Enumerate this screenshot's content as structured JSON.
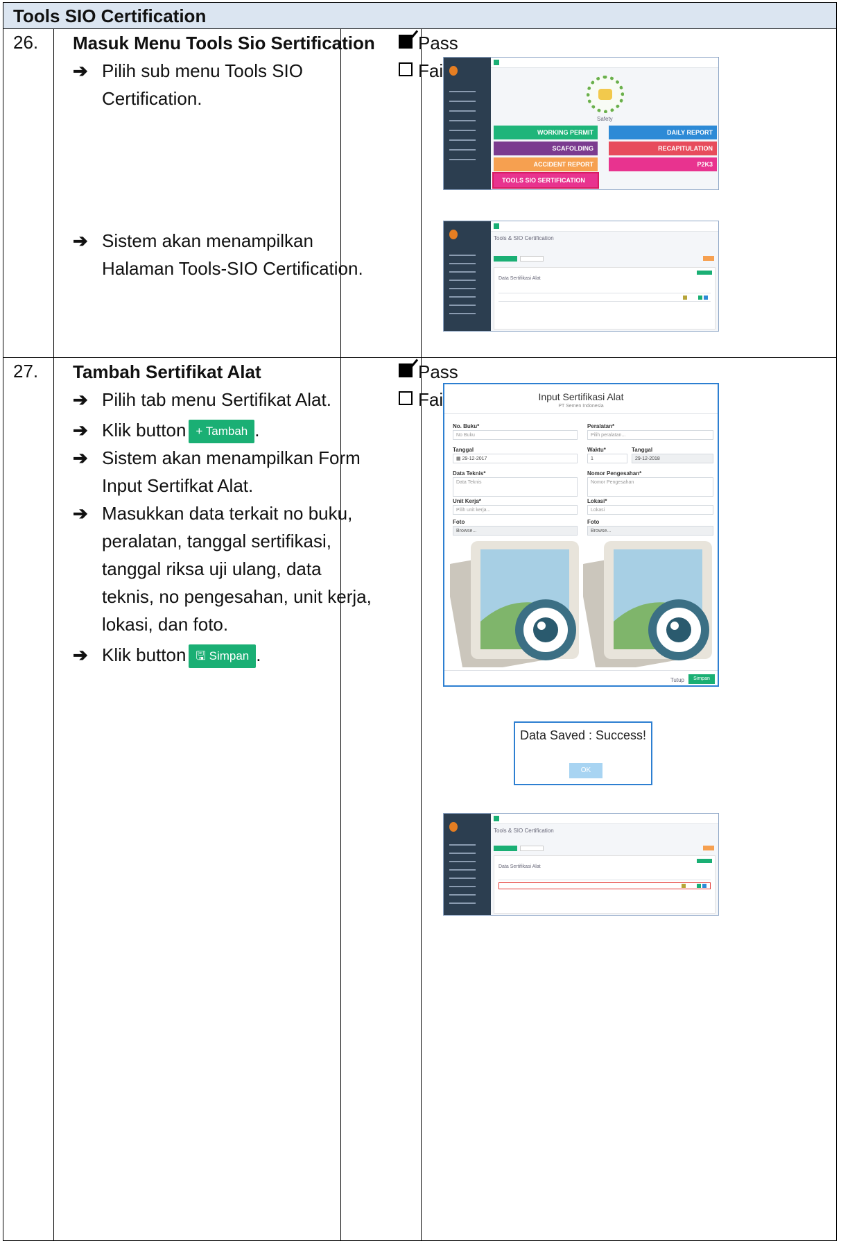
{
  "header": {
    "title": "Tools SIO Certification"
  },
  "rows": [
    {
      "number": "26.",
      "title": "Masuk Menu Tools Sio Sertification",
      "steps": [
        "Pilih sub menu Tools SIO Certification.",
        "Sistem akan menampilkan Halaman Tools-SIO Certification."
      ],
      "pass_label": "Pass",
      "fail_label": "Fail"
    },
    {
      "number": "27.",
      "title": "Tambah Sertifikat Alat",
      "steps": [
        "Pilih tab menu Sertifikat Alat.",
        "Klik button",
        "Sistem akan menampilkan Form Input Sertifkat Alat.",
        "Masukkan data terkait no buku, peralatan, tanggal sertifikasi, tanggal riksa uji ulang, data teknis, no pengesahan, unit kerja, lokasi, dan foto.",
        "Klik button"
      ],
      "tambah_label": "+ Tambah",
      "simpan_label": "Simpan",
      "pass_label": "Pass",
      "fail_label": "Fail"
    }
  ],
  "safety_menu": {
    "caption": "Safety",
    "tiles": [
      "WORKING PERMIT",
      "DAILY REPORT",
      "SCAFOLDING",
      "RECAPITULATION",
      "ACCIDENT REPORT",
      "P2K3",
      "TOOLS SIO SERTIFICATION"
    ],
    "colors": {
      "green": "#1fb57a",
      "blue": "#2d8ad6",
      "purple": "#7b3b8f",
      "red": "#e74c5c",
      "orange": "#f6a050",
      "pink": "#e8338f"
    }
  },
  "tools_page": {
    "title": "Tools & SIO Certification",
    "table_title": "Data Sertifikasi Alat"
  },
  "form": {
    "title": "Input Sertifikasi Alat",
    "subtitle": "PT Semen Indonesia",
    "no_buku_label": "No. Buku*",
    "no_buku_placeholder": "No Buku",
    "peralatan_label": "Peralatan*",
    "peralatan_placeholder": "Pilih peralatan...",
    "tanggal_label": "Tanggal",
    "tanggal_value": "29-12-2017",
    "waktu_label": "Waktu*",
    "waktu_value": "1",
    "tanggal2_label": "Tanggal",
    "tanggal2_value": "29-12-2018",
    "data_teknis_label": "Data Teknis*",
    "data_teknis_placeholder": "Data Teknis",
    "nomor_pengesahan_label": "Nomor Pengesahan*",
    "nomor_pengesahan_placeholder": "Nomor Pengesahan",
    "unit_kerja_label": "Unit Kerja*",
    "unit_kerja_placeholder": "Pilih unit kerja...",
    "lokasi_label": "Lokasi*",
    "lokasi_placeholder": "Lokasi",
    "foto_buku_label": "Foto",
    "foto_aktual_label": "Foto",
    "browse_label": "Browse...",
    "tutup_label": "Tutup",
    "simpan_label": "Simpan"
  },
  "dialog": {
    "message": "Data Saved : Success!",
    "ok_label": "OK"
  }
}
